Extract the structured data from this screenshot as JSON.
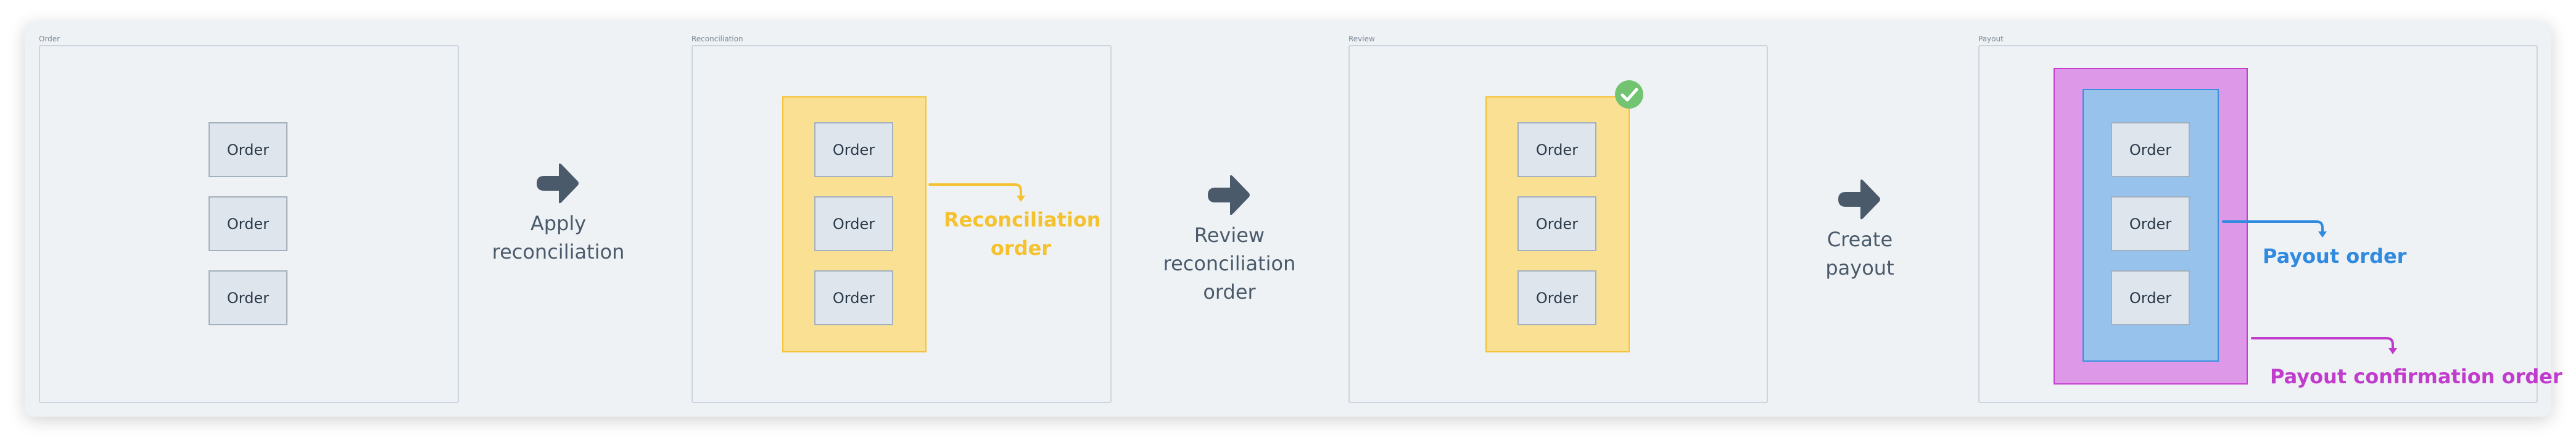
{
  "colors": {
    "card_bg": "#eff2f5",
    "section_border": "#cbd5df",
    "order_fill": "#dfe5ed",
    "order_border": "#a3b0bd",
    "step_text": "#4a5a6a",
    "reconciliation": "#f5c22f",
    "payout": "#2f8ae0",
    "payout_confirmation": "#c03ccc",
    "check": "#72c472"
  },
  "sections": [
    {
      "label": "Order",
      "orders": [
        "Order",
        "Order",
        "Order"
      ]
    },
    {
      "label": "Reconciliation",
      "orders": [
        "Order",
        "Order",
        "Order"
      ],
      "output_label_line1": "Reconciliation",
      "output_label_line2": "order"
    },
    {
      "label": "Review",
      "orders": [
        "Order",
        "Order",
        "Order"
      ],
      "status_icon": "check-circle-icon"
    },
    {
      "label": "Payout",
      "orders": [
        "Order",
        "Order",
        "Order"
      ],
      "inner_output_label": "Payout order",
      "outer_output_label": "Payout confirmation order"
    }
  ],
  "steps": [
    {
      "icon": "arrow-right-icon",
      "line1": "Apply",
      "line2": "reconciliation"
    },
    {
      "icon": "arrow-right-icon",
      "line1": "Review",
      "line2": "reconciliation order"
    },
    {
      "icon": "arrow-right-icon",
      "line1": "Create",
      "line2": "payout"
    }
  ]
}
